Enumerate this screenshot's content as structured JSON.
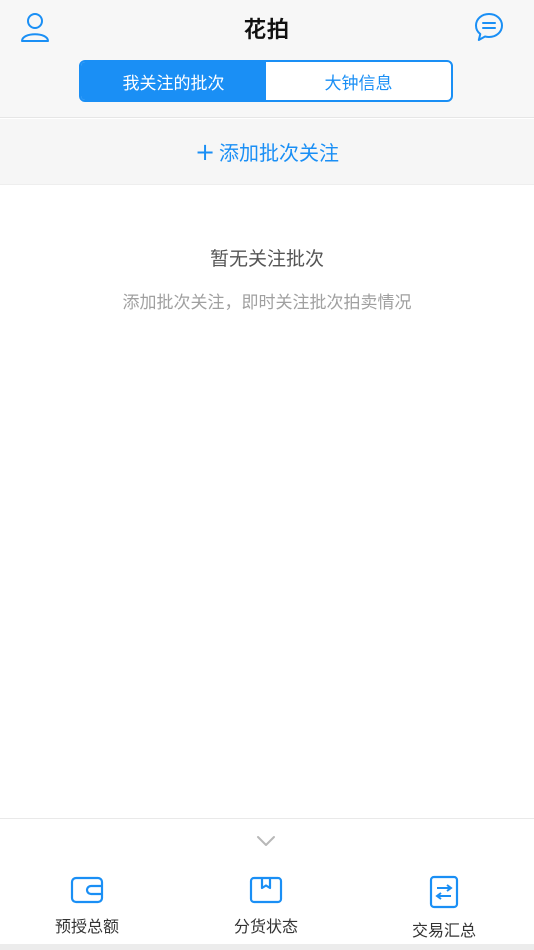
{
  "header": {
    "title": "花拍",
    "left_icon": "user-icon",
    "right_icon": "message-icon"
  },
  "segments": [
    {
      "label": "我关注的批次",
      "active": true
    },
    {
      "label": "大钟信息",
      "active": false
    }
  ],
  "add_follow": {
    "plus": "+",
    "label": "添加批次关注"
  },
  "empty_state": {
    "title": "暂无关注批次",
    "subtitle": "添加批次关注，即时关注批次拍卖情况"
  },
  "bottom_nav": {
    "expand_icon": "chevron-down-icon",
    "items": [
      {
        "label": "预授总额",
        "icon": "wallet-icon"
      },
      {
        "label": "分货状态",
        "icon": "box-icon"
      },
      {
        "label": "交易汇总",
        "icon": "exchange-icon"
      }
    ]
  },
  "colors": {
    "accent": "#1a8ff5",
    "header_bg": "#f7f7f7",
    "text_muted": "#a0a0a0"
  }
}
